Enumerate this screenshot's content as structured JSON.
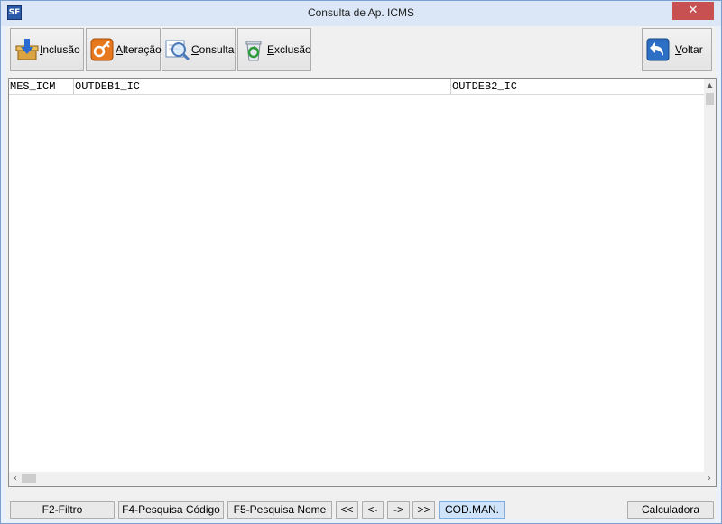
{
  "window": {
    "title": "Consulta  de Ap. ICMS",
    "close_glyph": "✕"
  },
  "toolbar": {
    "inclusao": {
      "accel": "I",
      "rest": "nclusão"
    },
    "alteracao": {
      "accel": "A",
      "rest": "lteração"
    },
    "consulta": {
      "accel": "C",
      "rest": "onsulta"
    },
    "exclusao": {
      "accel": "E",
      "rest": "xclusão"
    },
    "voltar": {
      "accel": "V",
      "rest": "oltar"
    }
  },
  "grid": {
    "columns": [
      "MES_ICM",
      "OUTDEB1_IC",
      "OUTDEB2_IC"
    ],
    "rows": []
  },
  "status": {
    "f2": "F2-Filtro",
    "f4": "F4-Pesquisa Código",
    "f5": "F5-Pesquisa Nome",
    "first": "<<",
    "prev": "<-",
    "next": "->",
    "last": ">>",
    "codman": "COD.MAN.",
    "calc": "Calculadora"
  },
  "colors": {
    "titlebar": "#dbe7f6",
    "close": "#c75050",
    "highlight": "#cfe4fa"
  },
  "icons": [
    "app-icon",
    "inclusao-box-icon",
    "alteracao-key-icon",
    "consulta-magnifier-icon",
    "recycle-bin-icon",
    "back-arrow-icon"
  ]
}
